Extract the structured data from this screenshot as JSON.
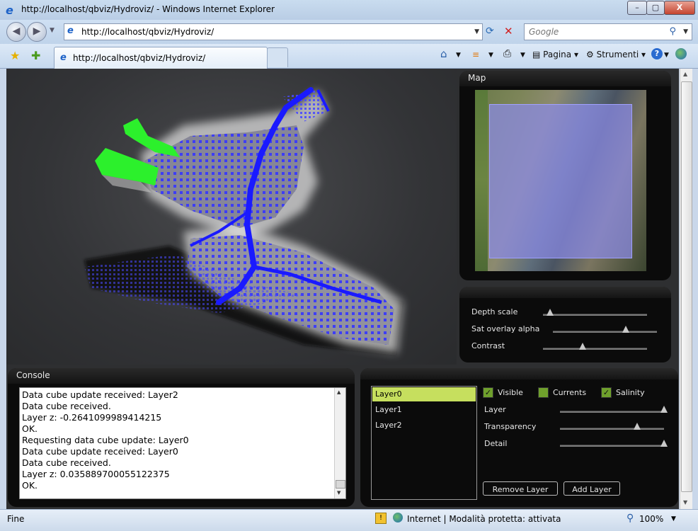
{
  "window": {
    "title": "http://localhost/qbviz/Hydroviz/ - Windows Internet Explorer",
    "buttons": {
      "minimize": "–",
      "maximize": "▢",
      "close": "X"
    }
  },
  "address_bar": {
    "url": "http://localhost/qbviz/Hydroviz/",
    "search_placeholder": "Google"
  },
  "tab": {
    "label": "http://localhost/qbviz/Hydroviz/"
  },
  "command_bar": {
    "pagina": "Pagina",
    "strumenti": "Strumenti"
  },
  "map_panel": {
    "title": "Map"
  },
  "settings_panel": {
    "sliders": [
      {
        "label": "Depth scale",
        "value": 0.05
      },
      {
        "label": "Sat overlay alpha",
        "value": 0.7
      },
      {
        "label": "Contrast",
        "value": 0.38
      }
    ]
  },
  "console_panel": {
    "title": "Console",
    "lines": [
      "Data cube update received: Layer2",
      "Data cube received.",
      "Layer z: -0.2641099989414215",
      "OK.",
      "Requesting data cube update: Layer0",
      "Data cube update received: Layer0",
      "Data cube received.",
      "Layer z: 0.035889700055122375",
      "OK."
    ]
  },
  "layers_panel": {
    "layers": [
      "Layer0",
      "Layer1",
      "Layer2"
    ],
    "selected": "Layer0",
    "checkboxes": [
      {
        "label": "Visible",
        "checked": true
      },
      {
        "label": "Currents",
        "checked": false
      },
      {
        "label": "Salinity",
        "checked": true
      }
    ],
    "sliders": [
      {
        "label": "Layer",
        "value": 1.0
      },
      {
        "label": "Transparency",
        "value": 0.75
      },
      {
        "label": "Detail",
        "value": 1.0
      }
    ],
    "buttons": {
      "remove": "Remove Layer",
      "add": "Add Layer"
    }
  },
  "status_bar": {
    "left": "Fine",
    "zone": "Internet | Modalità protetta: attivata",
    "zoom": "100%"
  },
  "colors": {
    "mesh_blue": "#1a1aff",
    "green_region": "#2cf02c",
    "selected_layer": "#c6df5e",
    "map_overlay": "#8a8ae8"
  }
}
